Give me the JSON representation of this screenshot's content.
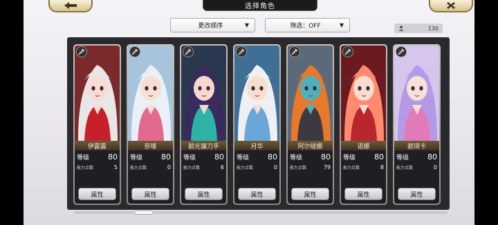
{
  "header": {
    "title": "选择角色",
    "sort_label": "更改顺序",
    "filter_label": "筛选：OFF",
    "caret": "▼",
    "count": "130"
  },
  "card_labels": {
    "level": "等级",
    "ability": "能力点数",
    "attr_button": "属性"
  },
  "characters": [
    {
      "name": "伊露露",
      "level": "80",
      "ability": "5",
      "hair": "#e8e6e6",
      "accent": "#c8202a",
      "skin": "#f6dcd2",
      "bg": "#7a2a2a"
    },
    {
      "name": "奈唛",
      "level": "80",
      "ability": "0",
      "hair": "#e9f0fa",
      "accent": "#e36a8c",
      "skin": "#f7e0d2",
      "bg": "#a8c4dc"
    },
    {
      "name": "碧光镰刀手",
      "level": "80",
      "ability": "6",
      "hair": "#3a2a5e",
      "accent": "#2bb3a6",
      "skin": "#f4d9cf",
      "bg": "#2a3850"
    },
    {
      "name": "月华",
      "level": "80",
      "ability": "0",
      "hair": "#eef0f4",
      "accent": "#6ba6d8",
      "skin": "#f6dfd0",
      "bg": "#3f6f95"
    },
    {
      "name": "阿尔缇娜",
      "level": "80",
      "ability": "79",
      "hair": "#e8782a",
      "accent": "#3a3a40",
      "skin": "#4fb0bd",
      "bg": "#5a6a7a"
    },
    {
      "name": "诺娜",
      "level": "80",
      "ability": "8",
      "hair": "#ff8a6e",
      "accent": "#b8262e",
      "skin": "#f7dccf",
      "bg": "#6a1a20"
    },
    {
      "name": "碧琪卡",
      "level": "80",
      "ability": "0",
      "hair": "#b49ae6",
      "accent": "#e27ab8",
      "skin": "#f7e0d8",
      "bg": "#d6c6ee"
    }
  ],
  "icons": {
    "back": "back-arrow-icon",
    "close": "close-x-icon",
    "count": "person-icon",
    "type": "weapon-type-icon"
  }
}
